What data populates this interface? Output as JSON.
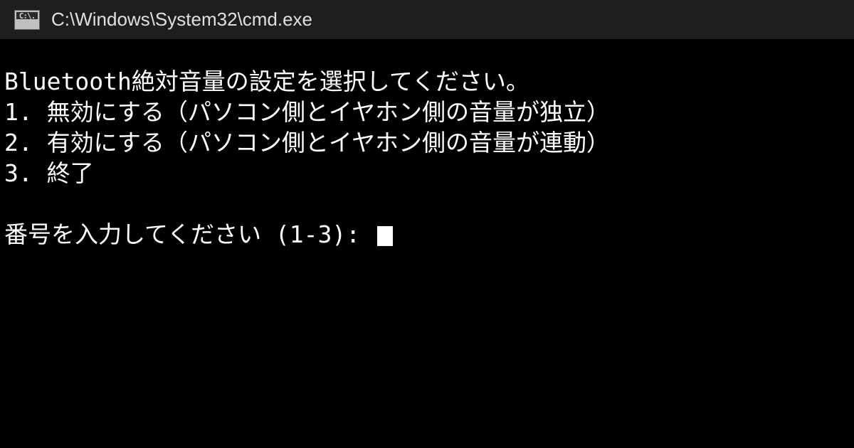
{
  "titlebar": {
    "title": "C:\\Windows\\System32\\cmd.exe",
    "icon_label": "C:\\"
  },
  "terminal": {
    "header": "Bluetooth絶対音量の設定を選択してください。",
    "options": [
      "1. 無効にする（パソコン側とイヤホン側の音量が独立）",
      "2. 有効にする（パソコン側とイヤホン側の音量が連動）",
      "3. 終了"
    ],
    "prompt": "番号を入力してください (1-3): "
  }
}
